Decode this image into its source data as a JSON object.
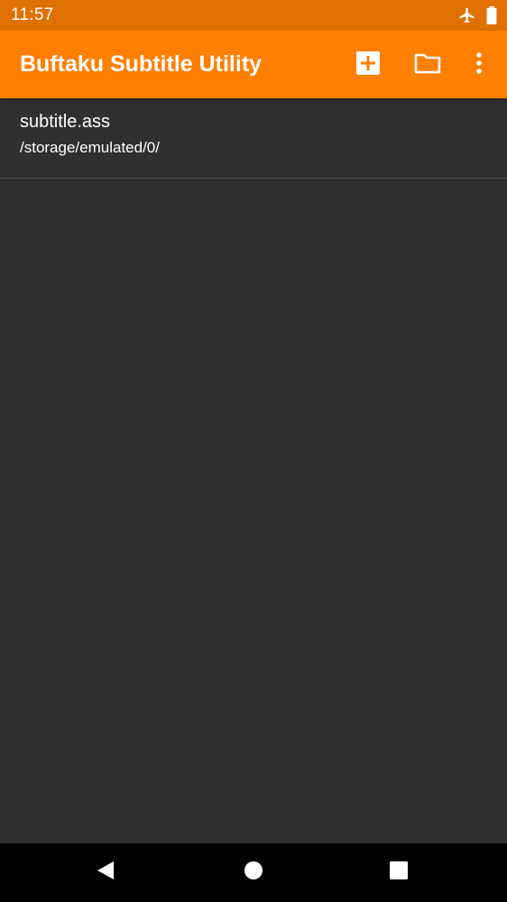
{
  "status_bar": {
    "time": "11:57",
    "icons": [
      "airplane-mode-icon",
      "battery-icon"
    ]
  },
  "app_bar": {
    "title": "Buftaku Subtitle Utility",
    "background_color": "#FF7F00",
    "actions": [
      "add-box-icon",
      "folder-icon",
      "more-vert-icon"
    ]
  },
  "files": [
    {
      "name": "subtitle.ass",
      "path": "/storage/emulated/0/"
    }
  ],
  "nav_bar": {
    "buttons": [
      "back-icon",
      "home-icon",
      "recents-icon"
    ]
  },
  "colors": {
    "status_bar": "#E07000",
    "content_background": "#303030",
    "divider": "#4a4a4a"
  }
}
